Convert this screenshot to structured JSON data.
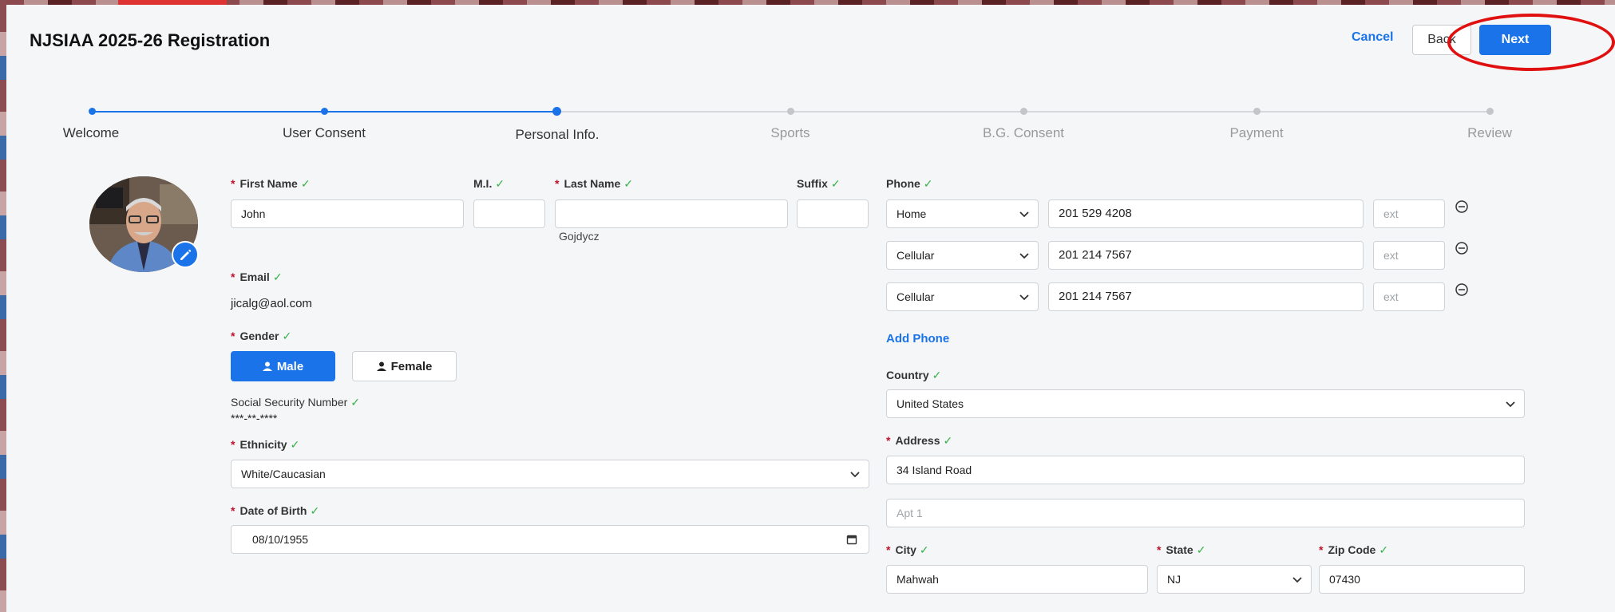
{
  "header": {
    "title": "NJSIAA 2025-26 Registration",
    "cancel_label": "Cancel",
    "back_label": "Back",
    "next_label": "Next"
  },
  "stepper": {
    "steps": [
      {
        "label": "Welcome",
        "state": "done"
      },
      {
        "label": "User Consent",
        "state": "done"
      },
      {
        "label": "Personal Info.",
        "state": "current"
      },
      {
        "label": "Sports",
        "state": "todo"
      },
      {
        "label": "B.G. Consent",
        "state": "todo"
      },
      {
        "label": "Payment",
        "state": "todo"
      },
      {
        "label": "Review",
        "state": "todo"
      }
    ]
  },
  "form": {
    "first_name": {
      "label": "First Name",
      "value": "John"
    },
    "mi": {
      "label": "M.I.",
      "value": ""
    },
    "last_name": {
      "label": "Last Name",
      "value": "",
      "below": "Gojdycz"
    },
    "suffix": {
      "label": "Suffix",
      "value": ""
    },
    "email": {
      "label": "Email",
      "value": "jicalg@aol.com"
    },
    "gender": {
      "label": "Gender",
      "male": "Male",
      "female": "Female",
      "selected": "Male"
    },
    "ssn": {
      "label": "Social Security Number",
      "value": "***-**-****"
    },
    "ethnicity": {
      "label": "Ethnicity",
      "value": "White/Caucasian"
    },
    "dob": {
      "label": "Date of Birth",
      "value": "08/10/1955"
    },
    "phone": {
      "label": "Phone",
      "ext_placeholder": "ext",
      "entries": [
        {
          "type": "Home",
          "number": "201 529 4208"
        },
        {
          "type": "Cellular",
          "number": "201 214 7567"
        },
        {
          "type": "Cellular",
          "number": "201 214 7567"
        }
      ],
      "add_label": "Add Phone"
    },
    "country": {
      "label": "Country",
      "value": "United States"
    },
    "address": {
      "label": "Address",
      "line1": "34 Island Road",
      "line2_placeholder": "Apt 1"
    },
    "city": {
      "label": "City",
      "value": "Mahwah"
    },
    "state": {
      "label": "State",
      "value": "NJ"
    },
    "zip": {
      "label": "Zip Code",
      "value": "07430"
    }
  },
  "colors": {
    "accent": "#1a73e8",
    "required": "#c0102a",
    "check": "#38b24a",
    "annotation": "#e01010"
  }
}
